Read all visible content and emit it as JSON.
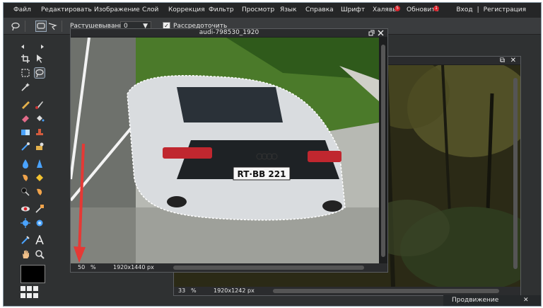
{
  "menubar": {
    "items": [
      "Файл",
      "Редактировать",
      "Изображение",
      "Слой",
      "Коррекция",
      "Фильтр",
      "Просмотр",
      "Язык",
      "Справка",
      "Шрифт",
      "Халявы",
      "Обновить"
    ],
    "badges": {
      "Халявы": "5",
      "Обновить": "1"
    },
    "login": "Вход",
    "separator": "|",
    "register": "Регистрация"
  },
  "options": {
    "feather_label": "Растушевывание:",
    "feather_value": "0",
    "feather_arrow": "▼",
    "antialias_label": "Рассредоточить",
    "antialias_checked": "✓"
  },
  "window_main": {
    "title": "audi-798530_1920",
    "zoom": "50",
    "zoom_unit": "%",
    "size": "1920x1440 px",
    "plate": "RT·BB 221",
    "close_icon": "close-icon",
    "restore_icon": "restore-icon"
  },
  "window_back": {
    "zoom": "33",
    "zoom_unit": "%",
    "size": "1920x1242 px",
    "restore": "⧉",
    "close": "✕"
  },
  "panel": {
    "label": "Продвижение",
    "close": "✕"
  },
  "colors": {
    "annotation_arrow": "#e53935",
    "badge": "#d8222a",
    "background": "#2f3132"
  }
}
